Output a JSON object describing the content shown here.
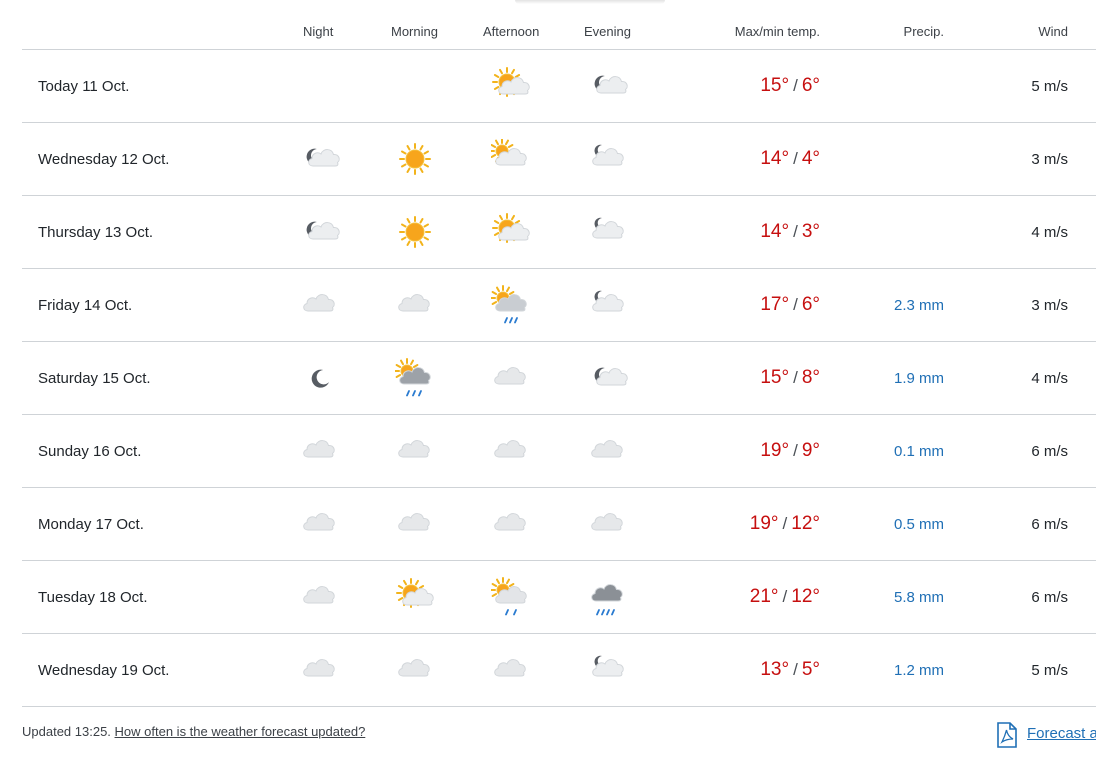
{
  "headers": {
    "night": "Night",
    "morning": "Morning",
    "afternoon": "Afternoon",
    "evening": "Evening",
    "temp": "Max/min temp.",
    "precip": "Precip.",
    "wind": "Wind"
  },
  "days": [
    {
      "date": "Today 11 Oct.",
      "night": "",
      "morning": "",
      "afternoon": "partly-cloudy-day-icon",
      "evening": "partly-cloudy-night-icon",
      "max": "15°",
      "min": "6°",
      "precip": "",
      "wind": "5 m/s"
    },
    {
      "date": "Wednesday 12 Oct.",
      "night": "partly-cloudy-night-icon",
      "morning": "sun-icon",
      "afternoon": "fair-cloud-day-icon",
      "evening": "cloudy-night-icon",
      "max": "14°",
      "min": "4°",
      "precip": "",
      "wind": "3 m/s"
    },
    {
      "date": "Thursday 13 Oct.",
      "night": "partly-cloudy-night-icon",
      "morning": "sun-icon",
      "afternoon": "partly-cloudy-day-icon",
      "evening": "cloudy-night-icon",
      "max": "14°",
      "min": "3°",
      "precip": "",
      "wind": "4 m/s"
    },
    {
      "date": "Friday 14 Oct.",
      "night": "cloud-icon",
      "morning": "cloud-icon",
      "afternoon": "rain-showers-day-icon",
      "evening": "cloudy-night-icon",
      "max": "17°",
      "min": "6°",
      "precip": "2.3 mm",
      "wind": "3 m/s"
    },
    {
      "date": "Saturday 15 Oct.",
      "night": "moon-icon",
      "morning": "rain-showers-day-dark-icon",
      "afternoon": "cloud-icon",
      "evening": "partly-cloudy-night-icon",
      "max": "15°",
      "min": "8°",
      "precip": "1.9 mm",
      "wind": "4 m/s"
    },
    {
      "date": "Sunday 16 Oct.",
      "night": "cloud-icon",
      "morning": "cloud-icon",
      "afternoon": "cloud-icon",
      "evening": "cloud-icon",
      "max": "19°",
      "min": "9°",
      "precip": "0.1 mm",
      "wind": "6 m/s"
    },
    {
      "date": "Monday 17 Oct.",
      "night": "cloud-icon",
      "morning": "cloud-icon",
      "afternoon": "cloud-icon",
      "evening": "cloud-icon",
      "max": "19°",
      "min": "12°",
      "precip": "0.5 mm",
      "wind": "6 m/s"
    },
    {
      "date": "Tuesday 18 Oct.",
      "night": "cloud-icon",
      "morning": "partly-cloudy-day-icon",
      "afternoon": "light-rain-day-icon",
      "evening": "rain-cloud-icon",
      "max": "21°",
      "min": "12°",
      "precip": "5.8 mm",
      "wind": "6 m/s"
    },
    {
      "date": "Wednesday 19 Oct.",
      "night": "cloud-icon",
      "morning": "cloud-icon",
      "afternoon": "cloud-icon",
      "evening": "cloudy-night-icon",
      "max": "13°",
      "min": "5°",
      "precip": "1.2 mm",
      "wind": "5 m/s"
    }
  ],
  "footer": {
    "updated": "Updated 13:25.",
    "link": "How often is the weather forecast updated?",
    "pdf": "Forecast as PDF"
  },
  "colors": {
    "temp": "#c60f0f",
    "precip": "#1f6fb5",
    "link": "#1f6fb5",
    "divider": "#cfd3d7"
  }
}
